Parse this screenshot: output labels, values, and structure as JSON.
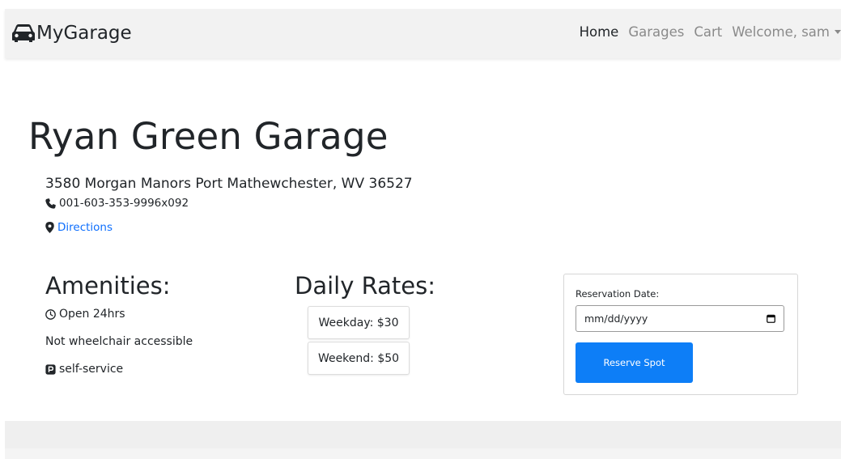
{
  "navbar": {
    "brand": "MyGarage",
    "links": [
      "Home",
      "Garages",
      "Cart"
    ],
    "user": "Welcome, sam"
  },
  "garage": {
    "name": "Ryan Green Garage",
    "address": "3580 Morgan Manors Port Mathewchester, WV 36527",
    "phone": "001-603-353-9996x092",
    "directions": "Directions"
  },
  "amenities": {
    "title": "Amenities:",
    "hours": "Open 24hrs",
    "accessibility": "Not wheelchair accessible",
    "service": "self-service"
  },
  "rates": {
    "title": "Daily Rates:",
    "weekday": "Weekday: $30",
    "weekend": "Weekend: $50"
  },
  "reservation": {
    "label": "Reservation Date:",
    "placeholder": "mm/dd/yyyy",
    "button": "Reserve Spot"
  },
  "colors": {
    "primary": "#0d7ef7",
    "link": "#0d6efd",
    "navbar_bg": "#f2f2f2"
  },
  "icons": {
    "brand": "car-icon",
    "phone": "phone-icon",
    "directions": "map-marker-icon",
    "hours": "clock-icon",
    "service": "parking-icon",
    "date": "calendar-icon",
    "user_menu": "caret-down-icon"
  }
}
